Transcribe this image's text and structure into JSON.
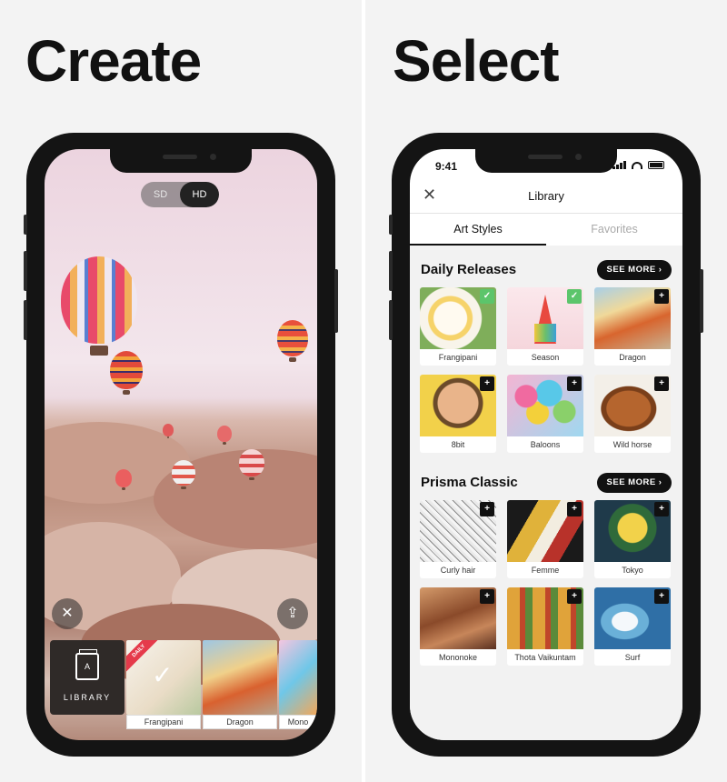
{
  "left_panel": {
    "headline": "Create",
    "quality_toggle": {
      "sd_label": "SD",
      "hd_label": "HD",
      "selected": "HD"
    },
    "close_glyph": "✕",
    "share_glyph": "⇪",
    "library_tile": {
      "icon_letter": "A",
      "label": "LIBRARY"
    },
    "style_strip": [
      {
        "name": "Frangipani",
        "selected": true,
        "badge": "DAILY"
      },
      {
        "name": "Dragon",
        "selected": false
      },
      {
        "name": "Mono",
        "selected": false
      }
    ]
  },
  "right_panel": {
    "headline": "Select",
    "status_bar": {
      "time": "9:41"
    },
    "header": {
      "close_glyph": "✕",
      "title": "Library"
    },
    "tabs": [
      {
        "label": "Art Styles",
        "active": true
      },
      {
        "label": "Favorites",
        "active": false
      }
    ],
    "sections": [
      {
        "title": "Daily Releases",
        "see_more": "SEE MORE ›",
        "items": [
          {
            "name": "Frangipani",
            "state": "✓"
          },
          {
            "name": "Season",
            "state": "✓"
          },
          {
            "name": "Dragon",
            "state": "+"
          },
          {
            "name": "8bit",
            "state": "+"
          },
          {
            "name": "Baloons",
            "state": "+"
          },
          {
            "name": "Wild horse",
            "state": "+"
          }
        ]
      },
      {
        "title": "Prisma Classic",
        "see_more": "SEE MORE ›",
        "items": [
          {
            "name": "Curly hair",
            "state": "+"
          },
          {
            "name": "Femme",
            "state": "+"
          },
          {
            "name": "Tokyo",
            "state": "+"
          },
          {
            "name": "Mononoke",
            "state": "+"
          },
          {
            "name": "Thota Vaikuntam",
            "state": "+"
          },
          {
            "name": "Surf",
            "state": "+"
          }
        ]
      }
    ]
  },
  "colors": {
    "accent_check": "#5cc56b",
    "badge_red": "#e53a4b",
    "button_dark": "#111111"
  }
}
